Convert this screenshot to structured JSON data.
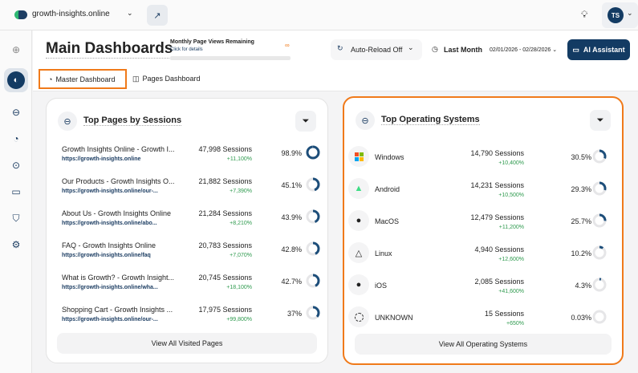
{
  "topbar": {
    "site": "growth-insights.online",
    "avatar": "TS"
  },
  "header": {
    "title": "Main Dashboards",
    "quota_label": "Monthly Page Views Remaining",
    "quota_link": "Click for details",
    "quota_value": "∞",
    "auto_reload": "Auto-Reload Off",
    "period": "Last Month",
    "date_range": "02/01/2026 - 02/28/2026",
    "ai_button": "AI Assistant"
  },
  "tabs": [
    {
      "label": "Master Dashboard",
      "active": true
    },
    {
      "label": "Pages Dashboard",
      "active": false
    }
  ],
  "colors": {
    "accent": "#133b63",
    "highlight": "#f07a1a",
    "positive": "#2e9a4e"
  },
  "pages": {
    "title": "Top Pages by Sessions",
    "view_all": "View All Visited Pages",
    "rows": [
      {
        "title": "Growth Insights Online - Growth I...",
        "url": "https://growth-insights.online",
        "sessions": "47,998 Sessions",
        "change": "+11,100%",
        "percent": "98.9%",
        "fraction": 0.989
      },
      {
        "title": "Our Products - Growth Insights O...",
        "url": "https://growth-insights.online/our-...",
        "sessions": "21,882 Sessions",
        "change": "+7,390%",
        "percent": "45.1%",
        "fraction": 0.451
      },
      {
        "title": "About Us - Growth Insights Online",
        "url": "https://growth-insights.online/abo...",
        "sessions": "21,284 Sessions",
        "change": "+8,210%",
        "percent": "43.9%",
        "fraction": 0.439
      },
      {
        "title": "FAQ - Growth Insights Online",
        "url": "https://growth-insights.online/faq",
        "sessions": "20,783 Sessions",
        "change": "+7,070%",
        "percent": "42.8%",
        "fraction": 0.428
      },
      {
        "title": "What is Growth? - Growth Insight...",
        "url": "https://growth-insights.online/wha...",
        "sessions": "20,745 Sessions",
        "change": "+18,100%",
        "percent": "42.7%",
        "fraction": 0.427
      },
      {
        "title": "Shopping Cart - Growth Insights ...",
        "url": "https://growth-insights.online/our-...",
        "sessions": "17,975 Sessions",
        "change": "+99,800%",
        "percent": "37%",
        "fraction": 0.37
      }
    ]
  },
  "os": {
    "title": "Top Operating Systems",
    "view_all": "View All Operating Systems",
    "rows": [
      {
        "name": "Windows",
        "icon": "windows-icon",
        "sessions": "14,790 Sessions",
        "change": "+10,400%",
        "percent": "30.5%",
        "fraction": 0.305
      },
      {
        "name": "Android",
        "icon": "android-icon",
        "sessions": "14,231 Sessions",
        "change": "+10,500%",
        "percent": "29.3%",
        "fraction": 0.293
      },
      {
        "name": "MacOS",
        "icon": "apple-icon",
        "sessions": "12,479 Sessions",
        "change": "+11,200%",
        "percent": "25.7%",
        "fraction": 0.257
      },
      {
        "name": "Linux",
        "icon": "linux-icon",
        "sessions": "4,940 Sessions",
        "change": "+12,600%",
        "percent": "10.2%",
        "fraction": 0.102
      },
      {
        "name": "iOS",
        "icon": "apple-icon",
        "sessions": "2,085 Sessions",
        "change": "+41,600%",
        "percent": "4.3%",
        "fraction": 0.043
      },
      {
        "name": "UNKNOWN",
        "icon": "unknown-icon",
        "sessions": "15 Sessions",
        "change": "+650%",
        "percent": "0.03%",
        "fraction": 0.0003
      }
    ]
  }
}
